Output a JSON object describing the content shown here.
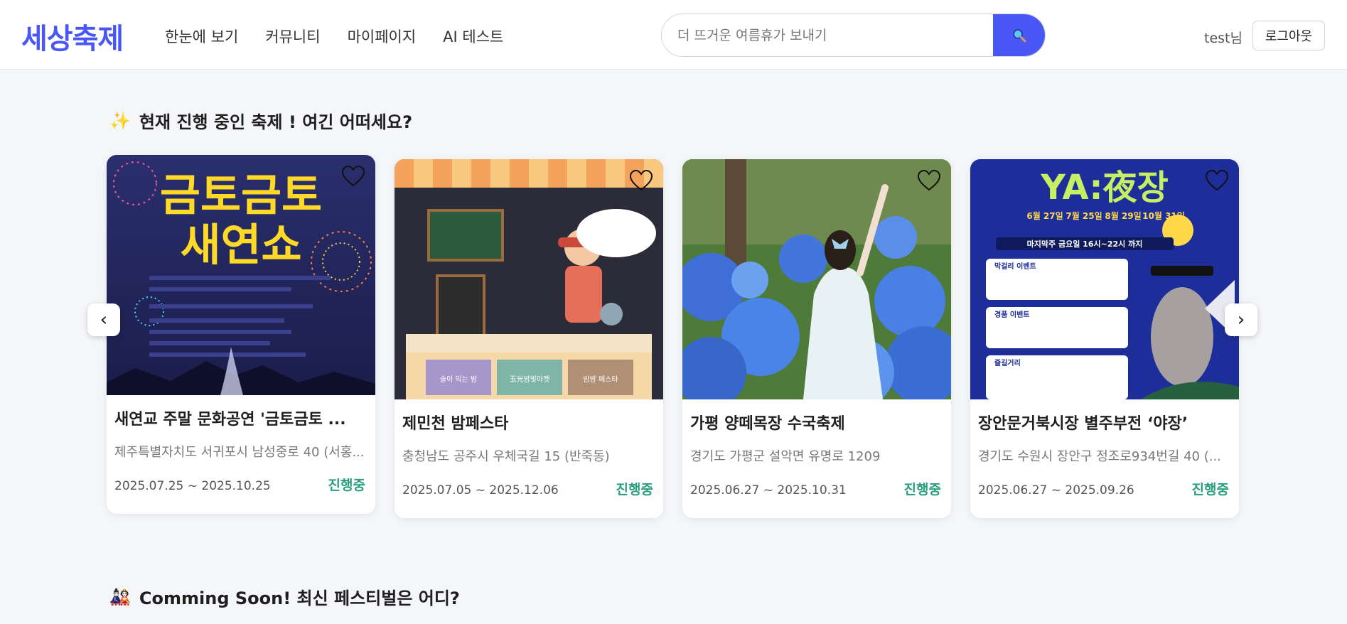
{
  "header": {
    "logo": "세상축제",
    "nav": [
      "한눈에 보기",
      "커뮤니티",
      "마이페이지",
      "AI 테스트"
    ],
    "search_placeholder": "더 뜨거운 여름휴가 보내기",
    "search_icon": "search-icon",
    "user_label": "test님",
    "logout_label": "로그아웃"
  },
  "sections": {
    "ongoing_emoji": "✨",
    "ongoing_title": "현재 진행 중인 축제 ! 여긴 어떠세요?",
    "soon_emoji": "🎎",
    "soon_title": "Comming Soon! 최신 페스티벌은 어디?"
  },
  "carousel": {
    "prev_label": "‹",
    "next_label": "›",
    "cards": [
      {
        "title": "새연교 주말 문화공연 '금토금토 ...",
        "address": "제주특별자치도 서귀포시 남성중로 40 (서홍...",
        "date": "2025.07.25 ~ 2025.10.25",
        "status": "진행중",
        "poster_text": [
          "금토금토",
          "새연쇼"
        ]
      },
      {
        "title": "제민천 밤페스타",
        "address": "충청남도 공주시 우체국길 15 (반죽동)",
        "date": "2025.07.05 ~ 2025.12.06",
        "status": "진행중",
        "poster_text": [
          "술이 익는 밤",
          "玉光밤빛마켓",
          "밤밤 페스타"
        ]
      },
      {
        "title": "가평 양떼목장 수국축제",
        "address": "경기도 가평군 설악면 유명로 1209",
        "date": "2025.06.27 ~ 2025.10.31",
        "status": "진행중",
        "poster_text": []
      },
      {
        "title": "장안문거북시장 별주부전 ‘야장’",
        "address": "경기도 수원시 장안구 정조로934번길 40 (...",
        "date": "2025.06.27 ~ 2025.09.26",
        "status": "진행중",
        "poster_text": [
          "YA:夜장",
          "6월 27일",
          "7월 25일",
          "8월 29일",
          "10월 31일",
          "마지막주 금요일 16시~22시 까지",
          "막걸리 이벤트",
          "경품 이벤트",
          "즐길거리"
        ]
      }
    ]
  },
  "colors": {
    "brand": "#4a57f7",
    "status": "#2a9d7f"
  }
}
